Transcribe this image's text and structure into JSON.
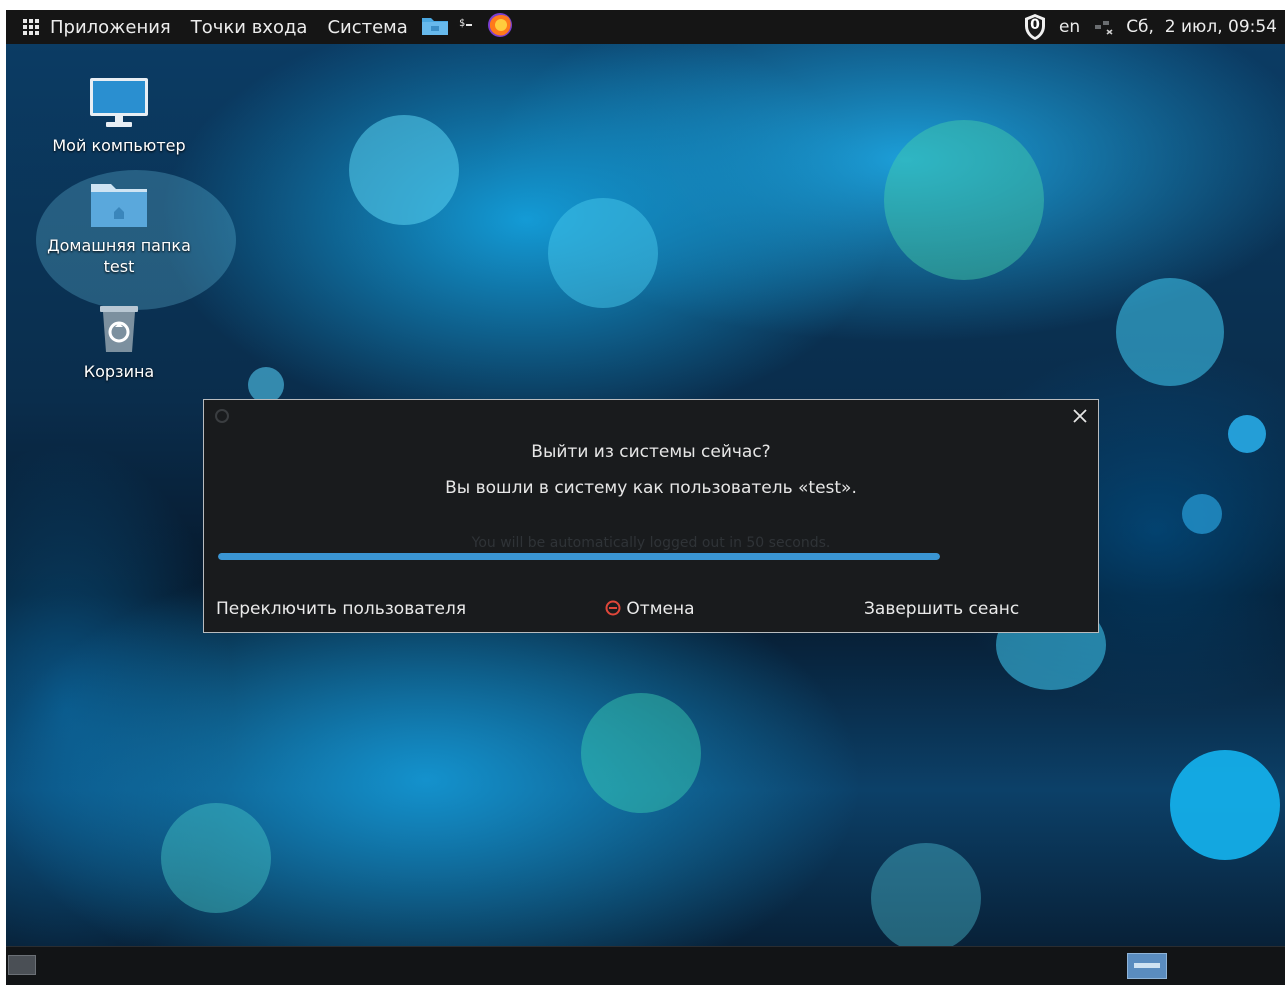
{
  "topbar": {
    "menu": [
      "Приложения",
      "Точки входа",
      "Система"
    ],
    "tray": {
      "badge": "0",
      "keyboard_layout": "en",
      "clock": "Сб,  2 июл, 09:54"
    }
  },
  "desktop": {
    "icons": [
      {
        "label": "Мой компьютер",
        "icon": "monitor-icon"
      },
      {
        "label_line1": "Домашняя папка",
        "label_line2": "test",
        "icon": "folder-icon"
      },
      {
        "label": "Корзина",
        "icon": "trash-icon"
      }
    ]
  },
  "dialog": {
    "title": "Выйти из системы сейчас?",
    "subtitle": "Вы вошли в систему как пользователь «test».",
    "auto_logout": "You will be automatically logged out in 50 seconds.",
    "progress": 1.0,
    "buttons": {
      "switch_user": "Переключить пользователя",
      "cancel": "Отмена",
      "logout": "Завершить сеанс"
    }
  },
  "colors": {
    "accent": "#3a95d3",
    "topbar": "#151515",
    "dialog_bg": "#191b1d",
    "cancel_icon": "#e0473a"
  }
}
